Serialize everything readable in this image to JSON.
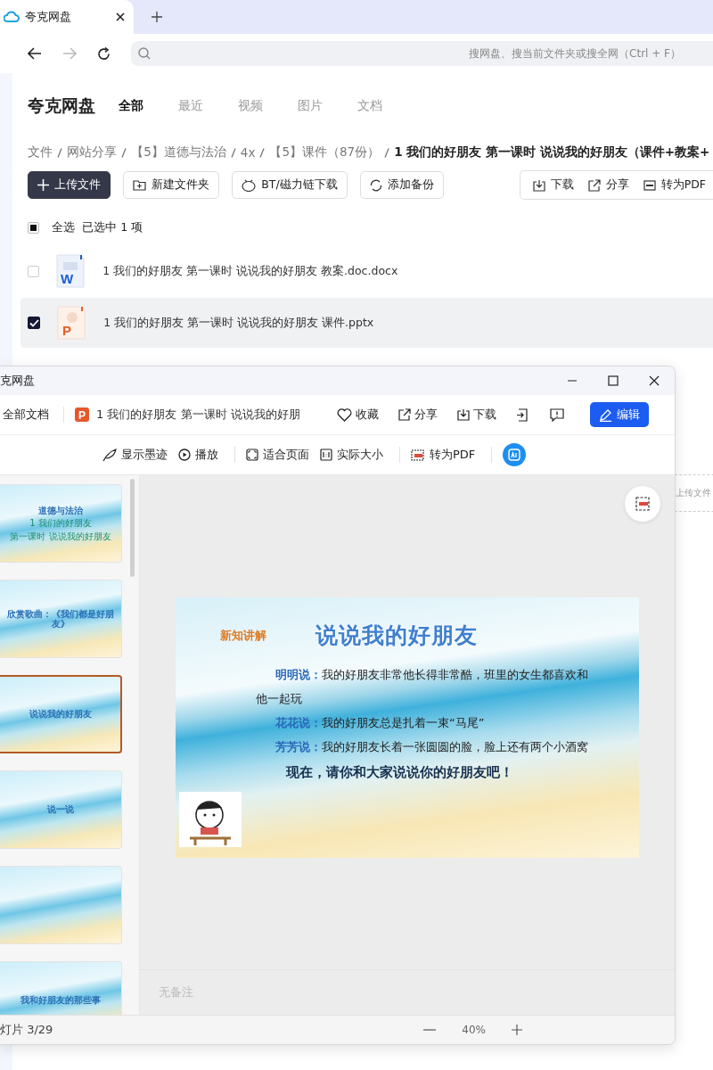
{
  "browser": {
    "tab_title": "夸克网盘",
    "search": {
      "placeholder": "搜网盘、搜当前文件夹或搜全网（Ctrl + F）"
    }
  },
  "app": {
    "logo": "夸克网盘",
    "tabs": [
      {
        "label": "全部",
        "selected": true
      },
      {
        "label": "最近",
        "selected": false
      },
      {
        "label": "视频",
        "selected": false
      },
      {
        "label": "图片",
        "selected": false
      },
      {
        "label": "文档",
        "selected": false
      }
    ]
  },
  "breadcrumb": [
    "文件",
    "网站分享",
    "【5】道德与法治",
    "4x",
    "【5】课件（87份）",
    "1 我们的好朋友 第一课时 说说我的好朋友（课件+教案+"
  ],
  "actions": [
    {
      "label": "上传文件",
      "kind": "upload"
    },
    {
      "label": "新建文件夹",
      "kind": "folder"
    },
    {
      "label": "BT/磁力链下载",
      "kind": "bt"
    },
    {
      "label": "添加备份",
      "kind": "backup"
    }
  ],
  "selection_actions": [
    {
      "label": "下载",
      "kind": "download"
    },
    {
      "label": "分享",
      "kind": "share"
    },
    {
      "label": "转为PDF",
      "kind": "pdf"
    }
  ],
  "select_all": {
    "label": "全选",
    "indeterminate": true,
    "summary": "已选中  1  项"
  },
  "files": [
    {
      "name": "1 我们的好朋友 第一课时 说说我的好朋友 教案.doc.docx",
      "kind": "word",
      "icon_letter": "W",
      "selected": false
    },
    {
      "name": "1 我们的好朋友 第一课时 说说我的好朋友 课件.pptx",
      "kind": "ppt",
      "icon_letter": "P",
      "selected": true
    }
  ],
  "drop_zone": {
    "label": "上传文件"
  },
  "viewer": {
    "title": "克网盘",
    "back": "全部文档",
    "file_icon_letter": "P",
    "file_name": "1 我们的好朋友 第一课时 说说我的好朋",
    "actions": [
      {
        "label": "收藏",
        "kind": "favorite"
      },
      {
        "label": "分享",
        "kind": "share"
      },
      {
        "label": "下载",
        "kind": "download"
      }
    ],
    "edit": "编辑",
    "tool_groups": [
      [
        {
          "label": "显示墨迹",
          "kind": "ink"
        },
        {
          "label": "播放",
          "kind": "play"
        }
      ],
      [
        {
          "label": "适合页面",
          "kind": "fit"
        },
        {
          "label": "实际大小",
          "kind": "actual"
        }
      ],
      [
        {
          "label": "转为PDF",
          "kind": "pdf"
        }
      ]
    ],
    "thumbnails": [
      {
        "title": "道德与法治",
        "lines": [
          "1 我们的好朋友",
          "第一课时 说说我的好朋友"
        ],
        "selected": false
      },
      {
        "title": "欣赏歌曲：《我们都是好朋友》",
        "selected": false
      },
      {
        "title": "说说我的好朋友",
        "selected": true
      },
      {
        "title": "说一说",
        "selected": false
      },
      {
        "selected": false
      },
      {
        "title": "我和好朋友的那些事",
        "selected": false
      }
    ],
    "slide": {
      "tag": "新知讲解",
      "title": "说说我的好朋友",
      "paragraphs": [
        "**明明说：**我的好朋友非常他长得非常酷，班里的女生都喜欢和他一起玩",
        "**花花说：**我的好朋友总是扎着一束“马尾”",
        "**芳芳说：**我的好朋友长着一张圆圆的脸，脸上还有两个小酒窝"
      ],
      "closing": "现在，请你和大家说说你的好朋友吧！"
    },
    "notes": "无备注",
    "status": "灯片 3/29",
    "zoom": "40%"
  }
}
